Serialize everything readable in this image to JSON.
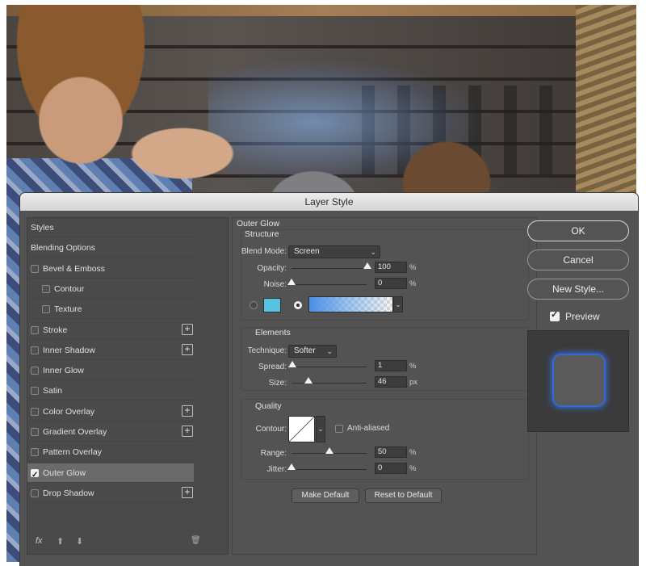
{
  "dialog": {
    "title": "Layer Style"
  },
  "styles_list": {
    "items": [
      {
        "label": "Styles",
        "has_checkbox": false,
        "checked": false,
        "add": false
      },
      {
        "label": "Blending Options",
        "has_checkbox": false,
        "checked": false,
        "add": false
      },
      {
        "label": "Bevel & Emboss",
        "has_checkbox": true,
        "checked": false,
        "add": false
      },
      {
        "label": "Contour",
        "has_checkbox": true,
        "checked": false,
        "add": false,
        "indent": true
      },
      {
        "label": "Texture",
        "has_checkbox": true,
        "checked": false,
        "add": false,
        "indent": true
      },
      {
        "label": "Stroke",
        "has_checkbox": true,
        "checked": false,
        "add": true
      },
      {
        "label": "Inner Shadow",
        "has_checkbox": true,
        "checked": false,
        "add": true
      },
      {
        "label": "Inner Glow",
        "has_checkbox": true,
        "checked": false,
        "add": false
      },
      {
        "label": "Satin",
        "has_checkbox": true,
        "checked": false,
        "add": false
      },
      {
        "label": "Color Overlay",
        "has_checkbox": true,
        "checked": false,
        "add": true
      },
      {
        "label": "Gradient Overlay",
        "has_checkbox": true,
        "checked": false,
        "add": true
      },
      {
        "label": "Pattern Overlay",
        "has_checkbox": true,
        "checked": false,
        "add": false
      },
      {
        "label": "Outer Glow",
        "has_checkbox": true,
        "checked": true,
        "add": false,
        "selected": true
      },
      {
        "label": "Drop Shadow",
        "has_checkbox": true,
        "checked": false,
        "add": true
      }
    ],
    "add_symbol": "+",
    "fx_label": "fx",
    "up_arrow": "⬆",
    "down_arrow": "⬇",
    "trash_icon": "🗑"
  },
  "outer_glow": {
    "section_title": "Outer Glow",
    "structure": {
      "title": "Structure",
      "blend_mode_label": "Blend Mode:",
      "blend_mode_value": "Screen",
      "opacity_label": "Opacity:",
      "opacity_value": "100",
      "opacity_unit": "%",
      "noise_label": "Noise:",
      "noise_value": "0",
      "noise_unit": "%",
      "glow_color": "#58c3e0"
    },
    "elements": {
      "title": "Elements",
      "technique_label": "Technique:",
      "technique_value": "Softer",
      "spread_label": "Spread:",
      "spread_value": "1",
      "spread_unit": "%",
      "size_label": "Size:",
      "size_value": "46",
      "size_unit": "px"
    },
    "quality": {
      "title": "Quality",
      "contour_label": "Contour:",
      "anti_aliased_label": "Anti-aliased",
      "range_label": "Range:",
      "range_value": "50",
      "range_unit": "%",
      "jitter_label": "Jitter:",
      "jitter_value": "0",
      "jitter_unit": "%"
    },
    "make_default_label": "Make Default",
    "reset_default_label": "Reset to Default"
  },
  "actions": {
    "ok_label": "OK",
    "cancel_label": "Cancel",
    "new_style_label": "New Style...",
    "preview_label": "Preview"
  }
}
